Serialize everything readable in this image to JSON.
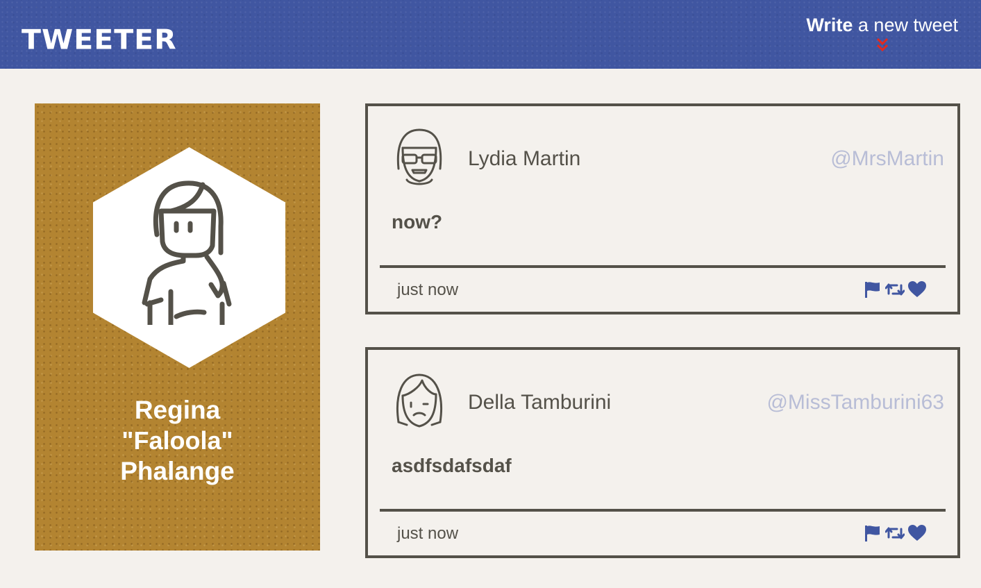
{
  "nav": {
    "brand": "TWEETER",
    "compose_bold": "Write",
    "compose_rest": " a new tweet",
    "compose_icon": "double-chevron-down-icon",
    "chevron_color": "#e3291e"
  },
  "profile": {
    "name_line1": "Regina",
    "name_line2": "\"Faloola\"",
    "name_line3": "Phalange",
    "avatar_icon": "woman-avatar-icon",
    "panel_color": "#b38431"
  },
  "tweets": [
    {
      "author": "Lydia Martin",
      "handle": "@MrsMartin",
      "body": "now?",
      "time": "just now",
      "avatar_icon": "sunglasses-girl-avatar-icon"
    },
    {
      "author": "Della Tamburini",
      "handle": "@MissTamburini63",
      "body": "asdfsdafsdaf",
      "time": "just now",
      "avatar_icon": "frowning-girl-avatar-icon"
    }
  ],
  "actions": [
    "flag-icon",
    "retweet-icon",
    "heart-icon"
  ],
  "colors": {
    "nav_bg": "#4056a1",
    "page_bg": "#f4f1ed",
    "text_dark": "#545149",
    "handle": "#b8bdd6",
    "action_icons": "#4056a1"
  }
}
